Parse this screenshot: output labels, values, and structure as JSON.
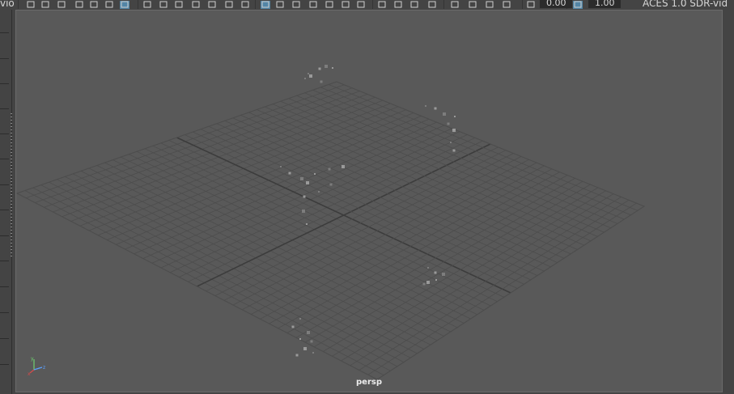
{
  "toolbar": {
    "menu_fragment": "vio",
    "exposure_value": "0.00",
    "gamma_value": "1.00",
    "color_space_label": "ACES 1.0 SDR-vid",
    "icons": [
      "camera-icon",
      "camera-attributes-icon",
      "bookmark-icon",
      "image-plane-icon",
      "2d-pan-zoom-icon",
      "grease-pencil-icon",
      "grid-icon",
      "film-gate-icon",
      "resolution-gate-icon",
      "gate-mask-icon",
      "field-chart-icon",
      "safe-action-icon",
      "safe-title-icon",
      "wireframe-icon",
      "smooth-shade-icon",
      "use-default-material-icon",
      "wireframe-on-shaded-icon",
      "textured-icon",
      "use-all-lights-icon",
      "shadows-icon",
      "screen-space-ao-icon",
      "motion-blur-icon",
      "anti-aliasing-icon",
      "depth-of-field-icon",
      "isolate-select-icon",
      "xray-icon",
      "xray-joints-icon",
      "xray-active-components-icon",
      "exposure-icon",
      "gamma-icon",
      "color-management-icon"
    ]
  },
  "viewport": {
    "camera_name": "persp",
    "axis": {
      "x": "x",
      "y": "y",
      "z": "z"
    }
  },
  "colors": {
    "panel_background": "#444444",
    "viewport_background": "#595959",
    "grid_line": "#4d4d4d",
    "grid_axis": "#3c3c3c",
    "active_button": "#5285a6",
    "axis_x": "#d84a4a",
    "axis_y": "#6fd16f",
    "axis_z": "#5aa0ff"
  }
}
